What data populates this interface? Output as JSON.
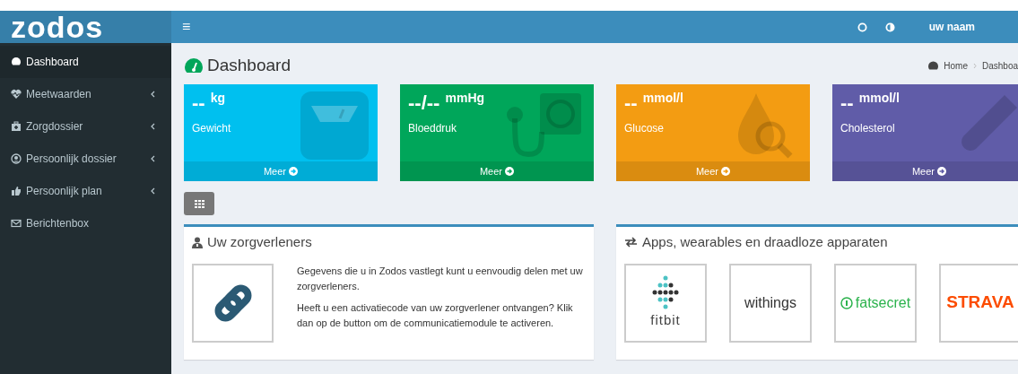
{
  "brand": "zodos",
  "header": {
    "menu_toggle": "≡",
    "user": "uw naam"
  },
  "sidebar": {
    "items": [
      {
        "label": "Dashboard",
        "kind": "gauge",
        "expandable": false,
        "selected": true
      },
      {
        "label": "Meetwaarden",
        "kind": "heart",
        "expandable": true,
        "selected": false
      },
      {
        "label": "Zorgdossier",
        "kind": "medkit",
        "expandable": true,
        "selected": false
      },
      {
        "label": "Persoonlijk dossier",
        "kind": "user",
        "expandable": true,
        "selected": false
      },
      {
        "label": "Persoonlijk plan",
        "kind": "thumb",
        "expandable": true,
        "selected": false
      },
      {
        "label": "Berichtenbox",
        "kind": "mail",
        "expandable": false,
        "selected": false
      }
    ]
  },
  "page": {
    "title": "Dashboard",
    "breadcrumb": [
      "Home",
      "Dashboa"
    ]
  },
  "stat_boxes": [
    {
      "value": "--",
      "unit": "kg",
      "label": "Gewicht",
      "link": "Meer",
      "color": "#00c0ef",
      "kind": "scale"
    },
    {
      "value": "--/--",
      "unit": "mmHg",
      "label": "Bloeddruk",
      "link": "Meer",
      "color": "#00a65a",
      "kind": "pressure"
    },
    {
      "value": "--",
      "unit": "mmol/l",
      "label": "Glucose",
      "link": "Meer",
      "color": "#f39c12",
      "kind": "drop"
    },
    {
      "value": "--",
      "unit": "mmol/l",
      "label": "Cholesterol",
      "link": "Meer",
      "color": "#605ca8",
      "kind": "tube"
    }
  ],
  "panels": [
    {
      "kind": "care",
      "title": "Uw zorgverleners",
      "paragraphs": [
        "Gegevens die u in Zodos vastlegt kunt u eenvoudig delen met uw zorgverleners.",
        "Heeft u een activatiecode van uw zorgverlener ontvangen? Klik dan op de button om de communicatiemodule te activeren."
      ]
    },
    {
      "kind": "apps",
      "title": "Apps, wearables en draadloze apparaten",
      "apps": [
        {
          "kind": "fitbit",
          "name": "fitbit"
        },
        {
          "kind": "withings",
          "name": "withings"
        },
        {
          "kind": "fatsecret",
          "name": "fatsecret"
        },
        {
          "kind": "strava",
          "name": "STRAVA"
        }
      ]
    }
  ]
}
